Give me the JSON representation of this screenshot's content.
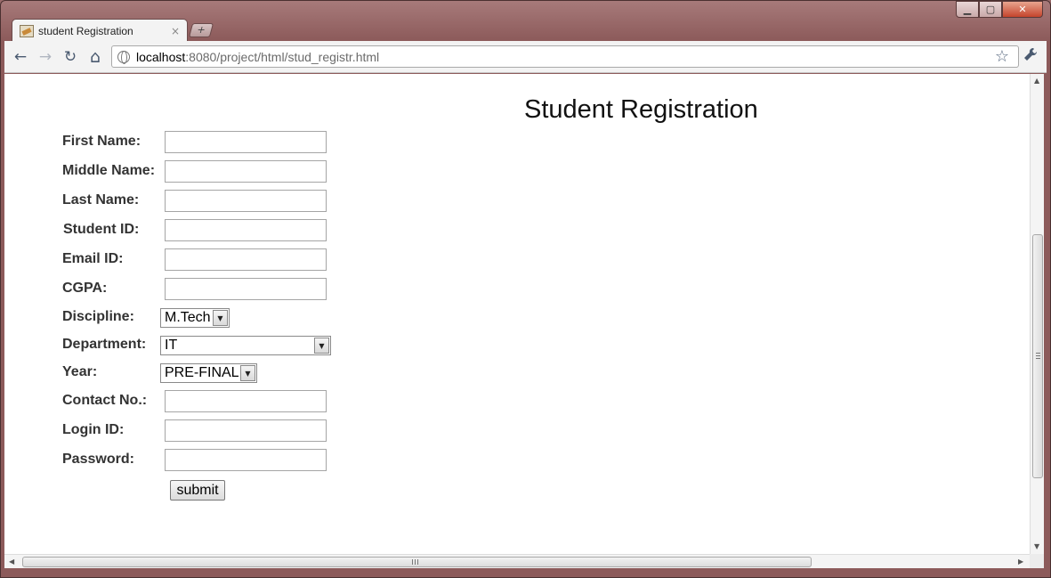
{
  "browser": {
    "tab_title": "student Registration",
    "tab_close": "×",
    "new_tab": "+",
    "url_host": "localhost",
    "url_rest": ":8080/project/html/stud_registr.html",
    "caption": {
      "minimize": "▁",
      "maximize": "▢",
      "close": "✕"
    },
    "icons": {
      "back": "←",
      "forward": "→",
      "reload": "↻",
      "home": "⌂",
      "star": "☆",
      "wrench": "🔧"
    }
  },
  "page": {
    "title": "Student Registration",
    "fields": [
      {
        "label": "First Name:",
        "value": ""
      },
      {
        "label": "Middle Name:",
        "value": ""
      },
      {
        "label": "Last Name:",
        "value": ""
      },
      {
        "label": "Student ID:",
        "value": ""
      },
      {
        "label": "Email ID:",
        "value": ""
      },
      {
        "label": "CGPA:",
        "value": ""
      }
    ],
    "discipline": {
      "label": "Discipline:",
      "value": "M.Tech"
    },
    "department": {
      "label": "Department:",
      "value": "IT"
    },
    "year": {
      "label": "Year:",
      "value": "PRE-FINAL"
    },
    "fields2": [
      {
        "label": "Contact No.:",
        "value": ""
      },
      {
        "label": "Login ID:",
        "value": ""
      },
      {
        "label": "Password:",
        "value": ""
      }
    ],
    "submit_label": "submit"
  }
}
